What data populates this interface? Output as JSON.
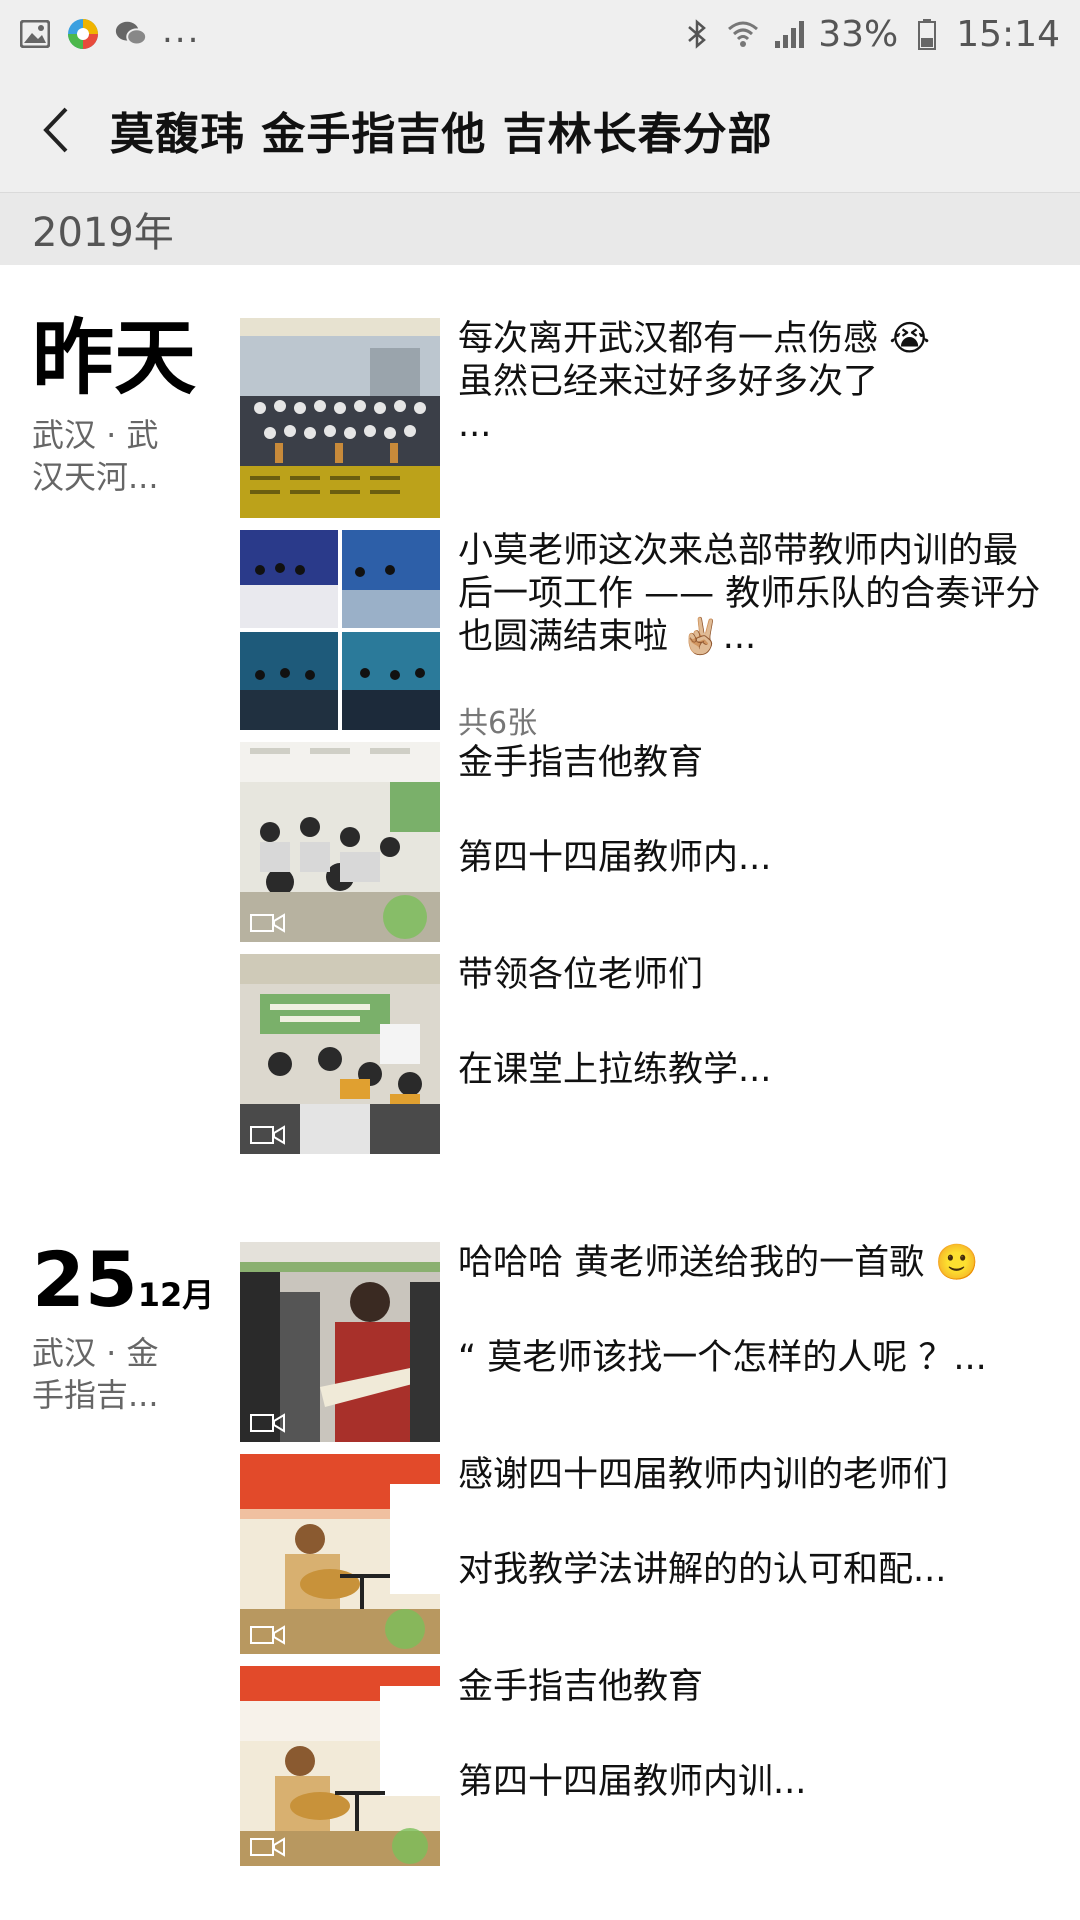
{
  "status_bar": {
    "left_icons": [
      "gallery-icon",
      "app-icon",
      "wechat-icon"
    ],
    "dots": "...",
    "battery": "33%",
    "time": "15:14",
    "right_icons": [
      "bluetooth-icon",
      "wifi-icon",
      "signal-icon",
      "battery-icon"
    ]
  },
  "header": {
    "title": "莫馥玮 金手指吉他 吉林长春分部"
  },
  "year_label": "2019年",
  "days": [
    {
      "date_label": "昨天",
      "location_lines": [
        "武汉 · 武",
        "汉天河..."
      ],
      "posts": [
        {
          "lines": [
            "每次离开武汉都有一点伤感 😭",
            "虽然已经来过好多好多次了",
            "..."
          ],
          "type": "photo"
        },
        {
          "lines": [
            "小莫老师这次来总部带教师内训的最",
            "后一项工作 —— 教师乐队的合奏评分",
            "也圆满结束啦 ✌🏼..."
          ],
          "count": "共6张",
          "type": "photo-grid"
        },
        {
          "lines": [
            "金手指吉他教育",
            "第四十四届教师内..."
          ],
          "type": "video"
        },
        {
          "lines": [
            "带领各位老师们",
            "在课堂上拉练教学..."
          ],
          "type": "video"
        }
      ]
    },
    {
      "date_num": "25",
      "date_month": "12月",
      "location_lines": [
        "武汉 · 金",
        "手指吉..."
      ],
      "posts": [
        {
          "lines": [
            "哈哈哈 黄老师送给我的一首歌 🙂",
            "“ 莫老师该找一个怎样的人呢 ？..."
          ],
          "type": "video"
        },
        {
          "lines": [
            "感谢四十四届教师内训的老师们",
            "对我教学法讲解的的认可和配..."
          ],
          "type": "video"
        },
        {
          "lines": [
            "金手指吉他教育",
            "第四十四届教师内训..."
          ],
          "type": "video"
        }
      ]
    }
  ]
}
